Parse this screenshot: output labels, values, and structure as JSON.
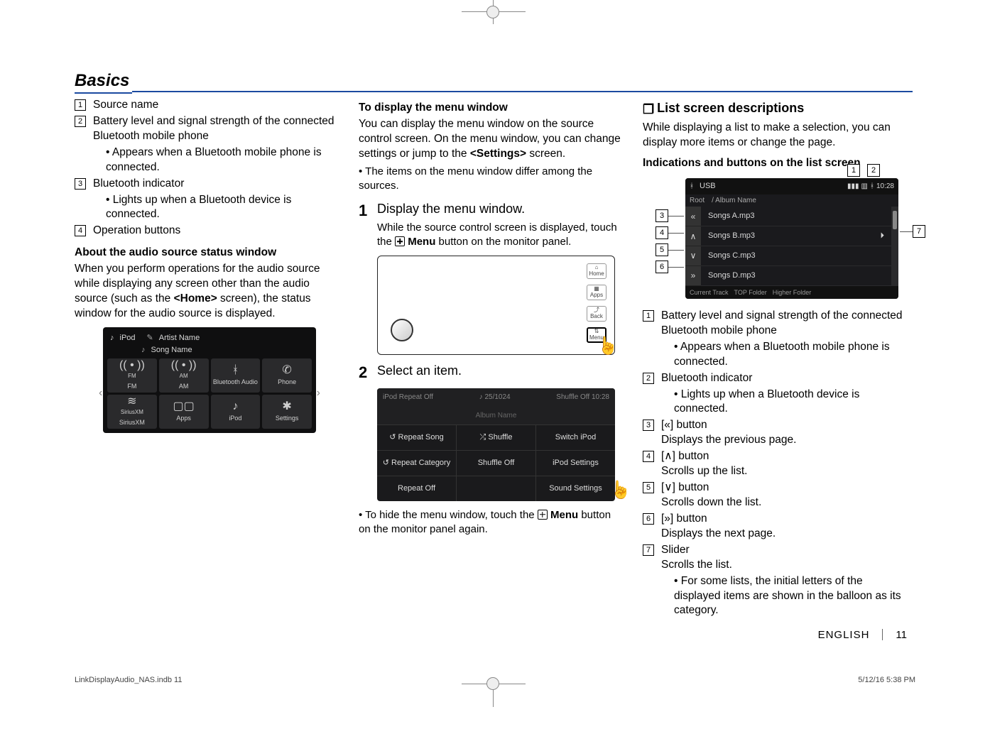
{
  "title": "Basics",
  "col1": {
    "items": [
      {
        "n": "1",
        "t": "Source name"
      },
      {
        "n": "2",
        "t": "Battery level and signal strength of the connected Bluetooth mobile phone",
        "sub": [
          "Appears when a Bluetooth mobile phone is connected."
        ]
      },
      {
        "n": "3",
        "t": "Bluetooth indicator",
        "sub": [
          "Lights up when a Bluetooth device is connected."
        ]
      },
      {
        "n": "4",
        "t": "Operation buttons"
      }
    ],
    "h": "About the audio source status window",
    "p": "When you perform operations for the audio source while displaying any screen other than the audio source (such as the <Home> screen), the status window for the audio source is displayed.",
    "src_top": {
      "icon": "♪",
      "src": "iPod",
      "artist": "Artist Name",
      "song": "Song Name"
    },
    "src_grid": [
      {
        "icon": "(( • ))",
        "sub": "FM",
        "label": "FM"
      },
      {
        "icon": "(( • ))",
        "sub": "AM",
        "label": "AM"
      },
      {
        "icon": "ᚼ",
        "sub": "",
        "label": "Bluetooth Audio"
      },
      {
        "icon": "✆",
        "sub": "",
        "label": "Phone"
      },
      {
        "icon": "≋",
        "sub": "SiriusXM",
        "label": "SiriusXM"
      },
      {
        "icon": "▢▢",
        "sub": "",
        "label": "Apps"
      },
      {
        "icon": "♪",
        "sub": "",
        "label": "iPod"
      },
      {
        "icon": "✱",
        "sub": "",
        "label": "Settings"
      }
    ]
  },
  "col2": {
    "h1": "To display the menu window",
    "p1a": "You can display the menu window on the source control screen. On the menu window, you can change settings or jump to the ",
    "p1b": "<Settings>",
    "p1c": " screen.",
    "p1_bul": [
      "The items on the menu window differ among the sources."
    ],
    "step1_n": "1",
    "step1_t": "Display the menu window.",
    "step1_sub_a": "While the source control screen is displayed, touch the ",
    "step1_sub_b": " Menu",
    "step1_sub_c": " button on the monitor panel.",
    "panel_btns": [
      {
        "ico": "⌂",
        "lab": "Home"
      },
      {
        "ico": "▦",
        "lab": "Apps"
      },
      {
        "ico": "⤴",
        "lab": "Back"
      },
      {
        "ico": "⇅",
        "lab": "Menu",
        "hl": true
      }
    ],
    "step2_n": "2",
    "step2_t": "Select an item.",
    "step2_hd_l": "iPod    Repeat Off",
    "step2_hd_m": "♪ 25/1024",
    "step2_hd_r": "Shuffle Off   10:28",
    "step2_sub": "Album Name",
    "step2_rows": [
      [
        "↺  Repeat Song",
        "⤮  Shuffle",
        "Switch iPod"
      ],
      [
        "↺  Repeat Category",
        "Shuffle Off",
        "iPod Settings"
      ],
      [
        "Repeat Off",
        "",
        "Sound Settings"
      ]
    ],
    "post_a": "To hide the menu window, touch the ",
    "post_b": " Menu",
    "post_c": " button on the monitor panel again."
  },
  "col3": {
    "h": "List screen descriptions",
    "intro": "While displaying a list to make a selection, you can display more items or change the page.",
    "h2": "Indications and buttons on the list screen",
    "callouts_top": [
      "1",
      "2"
    ],
    "callouts_left": [
      "3",
      "4",
      "5",
      "6"
    ],
    "callout_right": "7",
    "fig": {
      "bt": "ᚼ",
      "src": "USB",
      "sig": "▮▮▮",
      "bat": "▥",
      "bti": "ᚼ",
      "time": "10:28",
      "root": "Root",
      "album": "/ Album Name",
      "navs": [
        "«",
        "∧",
        "∨",
        "»"
      ],
      "rows": [
        {
          "t": "Songs A.mp3",
          "r": ""
        },
        {
          "t": "Songs B.mp3",
          "r": "⏵"
        },
        {
          "t": "Songs C.mp3",
          "r": ""
        },
        {
          "t": "Songs D.mp3",
          "r": ""
        }
      ],
      "foot": [
        "Current Track",
        "TOP Folder",
        "Higher Folder"
      ]
    },
    "desc": [
      {
        "n": "1",
        "t": "Battery level and signal strength of the connected Bluetooth mobile phone",
        "sub": [
          "Appears when a Bluetooth mobile phone is connected."
        ]
      },
      {
        "n": "2",
        "t": "Bluetooth indicator",
        "sub": [
          "Lights up when a Bluetooth device is connected."
        ]
      },
      {
        "n": "3",
        "t": "[«] button",
        "line2": "Displays the previous page."
      },
      {
        "n": "4",
        "t": "[∧] button",
        "line2": "Scrolls up the list."
      },
      {
        "n": "5",
        "t": "[∨] button",
        "line2": "Scrolls down the list."
      },
      {
        "n": "6",
        "t": "[»] button",
        "line2": "Displays the next page."
      },
      {
        "n": "7",
        "t": "Slider",
        "line2": "Scrolls the list.",
        "sub": [
          "For some lists, the initial letters of the displayed items are shown in the balloon as its category."
        ]
      }
    ]
  },
  "footer": {
    "lang": "ENGLISH",
    "page": "11"
  },
  "print": {
    "l": "LinkDisplayAudio_NAS.indb   11",
    "r": "5/12/16   5:38 PM"
  }
}
